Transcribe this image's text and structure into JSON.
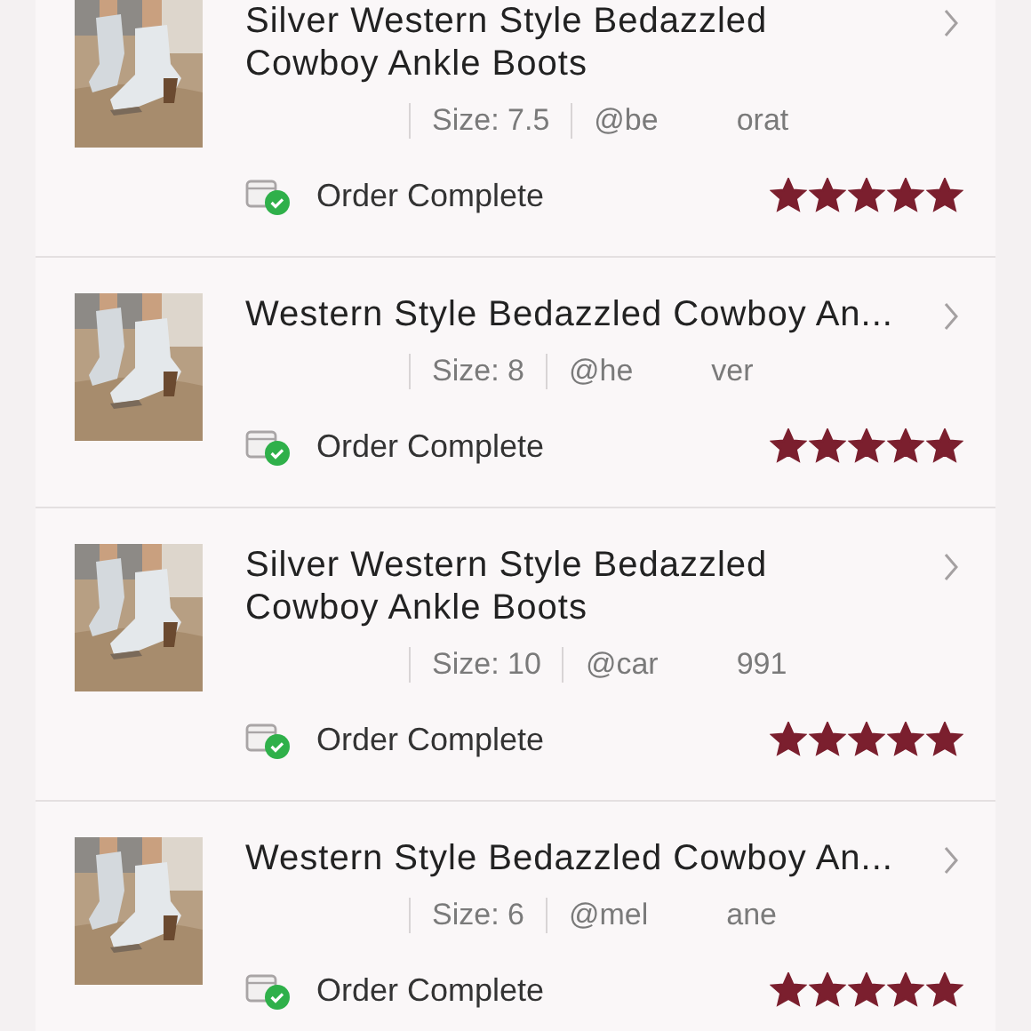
{
  "orders": [
    {
      "title": [
        "Silver Western Style Bedazzled",
        "Cowboy Ankle Boots"
      ],
      "size": "Size: 7.5",
      "user_start": "@be",
      "user_end": "orat",
      "status": "Order Complete",
      "stars": 5,
      "photo": {
        "kind": "picture"
      }
    },
    {
      "title": [
        "Western Style Bedazzled Cowboy An..."
      ],
      "size": "Size: 8",
      "user_start": "@he",
      "user_end": "ver",
      "status": "Order Complete",
      "stars": 5,
      "photo": {
        "kind": "picture"
      }
    },
    {
      "title": [
        "Silver Western Style Bedazzled",
        "Cowboy Ankle Boots"
      ],
      "size": "Size: 10",
      "user_start": "@car",
      "user_end": "991",
      "status": "Order Complete",
      "stars": 5,
      "photo": {
        "kind": "picture"
      }
    },
    {
      "title": [
        "Western Style Bedazzled Cowboy An..."
      ],
      "size": "Size: 6",
      "user_start": "@mel",
      "user_end": "ane",
      "status": "Order Complete",
      "stars": 5,
      "photo": {
        "kind": "picture"
      }
    }
  ]
}
